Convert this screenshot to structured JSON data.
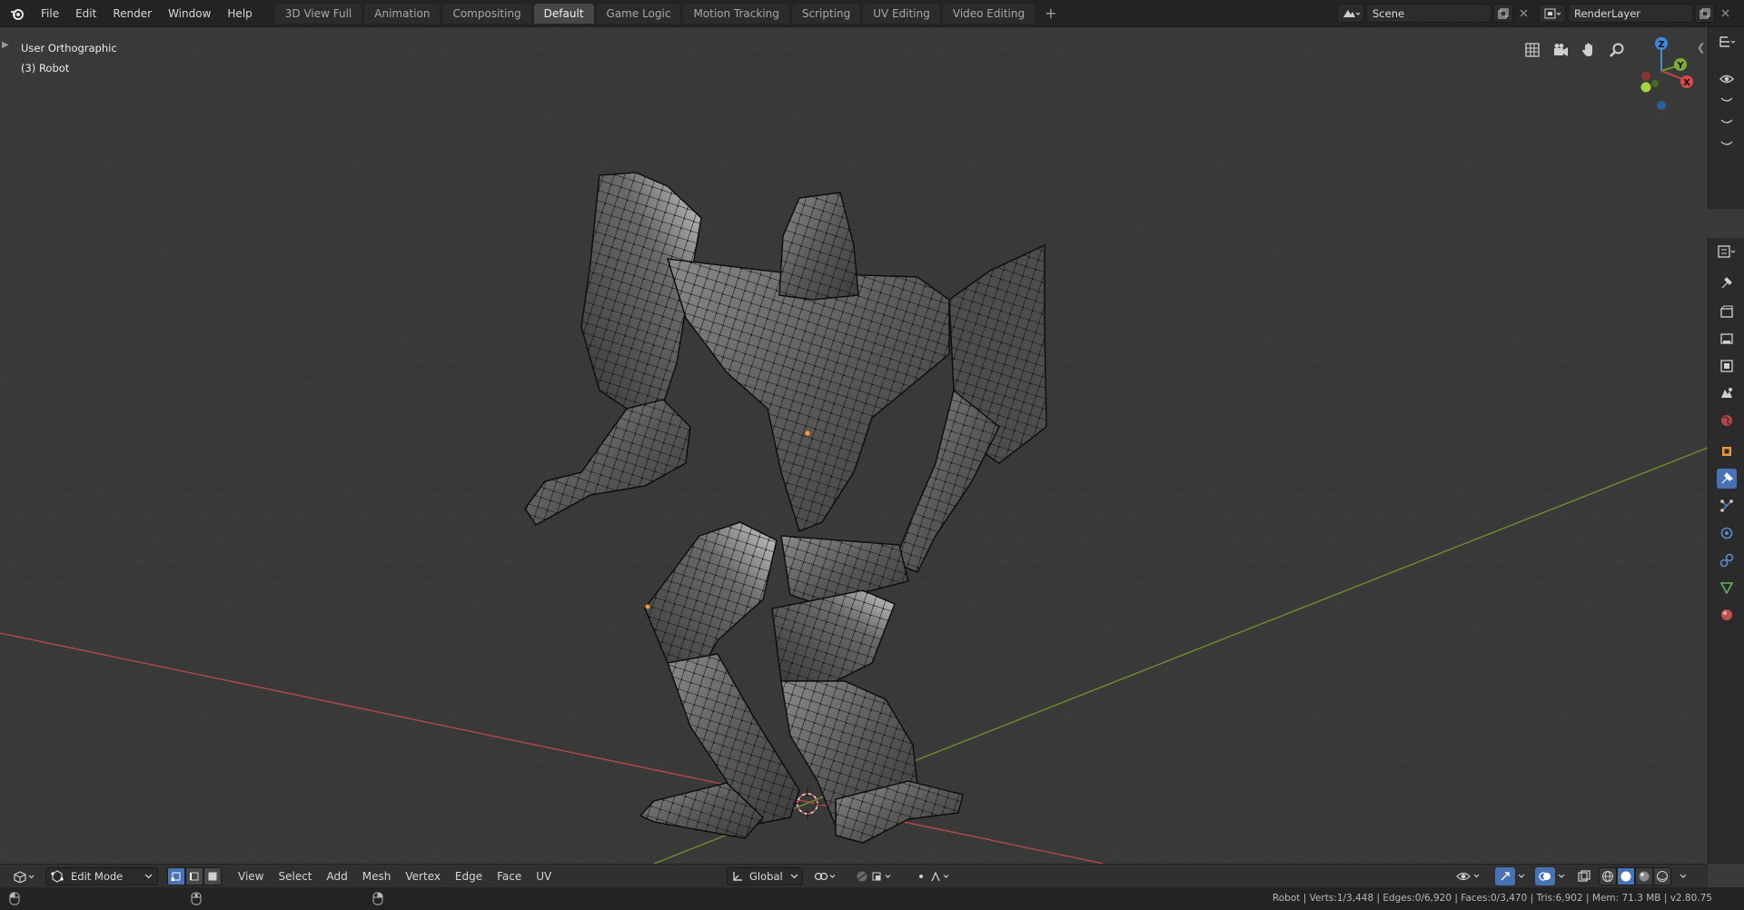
{
  "menu": {
    "file": "File",
    "edit": "Edit",
    "render": "Render",
    "window": "Window",
    "help": "Help"
  },
  "workspaces": [
    {
      "label": "3D View Full",
      "active": false
    },
    {
      "label": "Animation",
      "active": false
    },
    {
      "label": "Compositing",
      "active": false
    },
    {
      "label": "Default",
      "active": true
    },
    {
      "label": "Game Logic",
      "active": false
    },
    {
      "label": "Motion Tracking",
      "active": false
    },
    {
      "label": "Scripting",
      "active": false
    },
    {
      "label": "UV Editing",
      "active": false
    },
    {
      "label": "Video Editing",
      "active": false
    }
  ],
  "workspace_add": "+",
  "scene": {
    "name": "Scene",
    "render_layer": "RenderLayer"
  },
  "viewport": {
    "view_name": "User Orthographic",
    "object_label": "(3) Robot",
    "gizmo": {
      "z": "Z",
      "y": "Y",
      "x": "X"
    }
  },
  "header": {
    "mode": "Edit Mode",
    "menus": [
      "View",
      "Select",
      "Add",
      "Mesh",
      "Vertex",
      "Edge",
      "Face",
      "UV"
    ],
    "orientation": "Global"
  },
  "status": {
    "text": "Robot | Verts:1/3,448 | Edges:0/6,920 | Faces:0/3,470 | Tris:6,902 | Mem: 71.3 MB | v2.80.75"
  },
  "colors": {
    "accent_blue": "#4772b3",
    "x_axis": "#b34a4a",
    "y_axis": "#6e8f2c",
    "z_axis": "#3d8bd9",
    "active_vertex": "#ff9a2b"
  },
  "icons": {
    "outliner": [
      "outliner-icon",
      "eye-icon",
      "collapse-icon",
      "collapse-icon",
      "collapse-icon"
    ],
    "properties": [
      "properties-editor-icon",
      "tool-icon",
      "render-icon",
      "output-icon",
      "view-layer-icon",
      "scene-icon",
      "world-icon",
      "object-icon",
      "modifier-icon",
      "particles-icon",
      "physics-icon",
      "constraints-icon",
      "object-data-icon",
      "material-icon"
    ]
  }
}
